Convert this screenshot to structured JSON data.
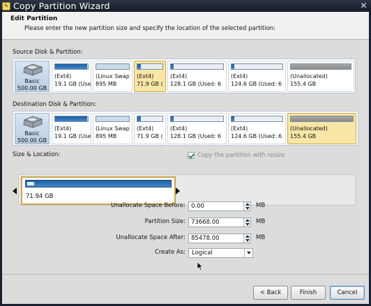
{
  "window": {
    "title": "Copy Partition Wizard"
  },
  "header": {
    "title": "Edit Partition",
    "subtitle": "Please enter the new partition size and specify the location of the selected partition:"
  },
  "source": {
    "label": "Source Disk & Partition:",
    "disk": {
      "line1": "Basic",
      "line2": "500.00 GB"
    },
    "partitions": [
      {
        "line1": "(Ext4)",
        "line2": "19.1 GB (Use",
        "fill_fraction": 0.98
      },
      {
        "line1": "(Linux Swap",
        "line2": "895 MB",
        "fill_fraction": 1.0
      },
      {
        "line1": "(Ext4)",
        "line2": "71.9 GB (",
        "fill_fraction": 0.15
      },
      {
        "line1": "(Ext4)",
        "line2": "128.1 GB (Used: 6",
        "fill_fraction": 0.05
      },
      {
        "line1": "(Ext4)",
        "line2": "124.6 GB (Used: 6",
        "fill_fraction": 0.05
      },
      {
        "line1": "(Unallocated)",
        "line2": "155.4 GB",
        "fill_fraction": 0
      }
    ]
  },
  "destination": {
    "label": "Destination Disk & Partition:",
    "disk": {
      "line1": "Basic",
      "line2": "500.00 GB"
    },
    "partitions": [
      {
        "line1": "(Ext4)",
        "line2": "19.1 GB (Use",
        "fill_fraction": 0.98
      },
      {
        "line1": "(Linux Swap",
        "line2": "895 MB",
        "fill_fraction": 1.0
      },
      {
        "line1": "(Ext4)",
        "line2": "71.9 GB (",
        "fill_fraction": 0.15
      },
      {
        "line1": "(Ext4)",
        "line2": "128.1 GB (Used: 6",
        "fill_fraction": 0.05
      },
      {
        "line1": "(Ext4)",
        "line2": "124.6 GB (Used: 6",
        "fill_fraction": 0.05
      },
      {
        "line1": "(Unallocated)",
        "line2": "155.4 GB",
        "fill_fraction": 0
      }
    ]
  },
  "size_location": {
    "label": "Size & Location:",
    "resize_checkbox": {
      "label": "Copy the partition with resize",
      "checked": true
    },
    "partition_label": "71.94 GB"
  },
  "form": {
    "unallocate_before": {
      "label": "Unallocate Space Before:",
      "value": "0.00",
      "unit": "MB"
    },
    "partition_size": {
      "label": "Partition Size:",
      "value": "73668.00",
      "unit": "MB"
    },
    "unallocate_after": {
      "label": "Unallocate Space After:",
      "value": "85478.00",
      "unit": "MB"
    },
    "create_as": {
      "label": "Create As:",
      "value": "Logical"
    }
  },
  "buttons": {
    "back": "< Back",
    "finish": "Finish",
    "cancel": "Cancel"
  }
}
